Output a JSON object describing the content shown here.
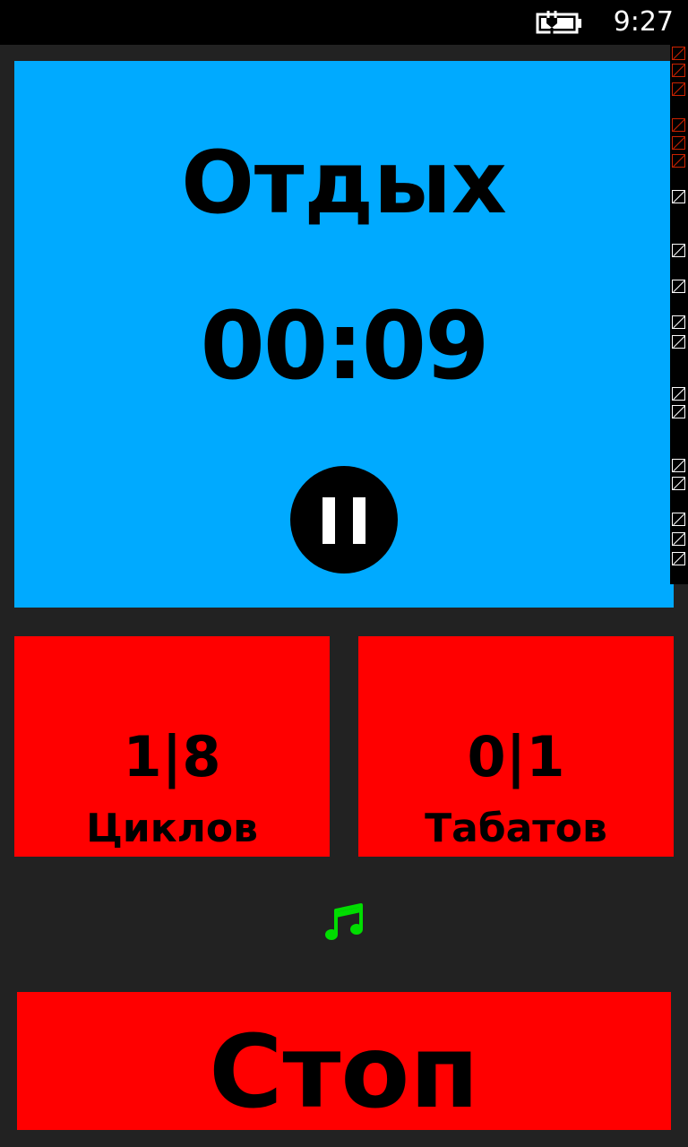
{
  "status_bar": {
    "time": "9:27",
    "battery_icon": "battery-charging-icon"
  },
  "timer_panel": {
    "phase": "Отдых",
    "time_remaining": "00:09",
    "pause_icon": "pause-icon",
    "background_color": "#00aaff"
  },
  "counters": [
    {
      "value": "1|8",
      "label": "Циклов"
    },
    {
      "value": "0|1",
      "label": "Табатов"
    }
  ],
  "music": {
    "icon": "music-note-icon",
    "color": "#00dd00"
  },
  "stop_button": {
    "label": "Стоп",
    "color": "#ff0000"
  }
}
